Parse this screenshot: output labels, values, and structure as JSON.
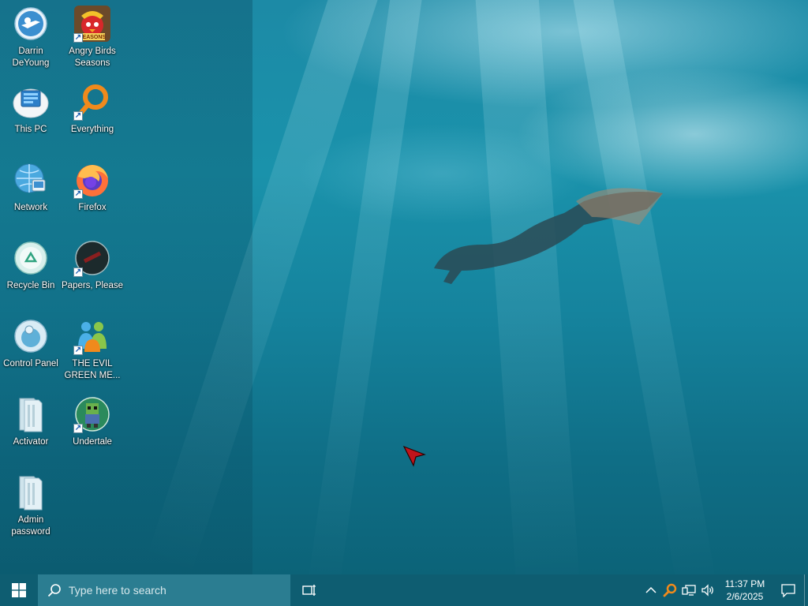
{
  "desktop": {
    "icons": [
      {
        "id": "darrin",
        "label": "Darrin DeYoung",
        "icon": "user-folder-icon",
        "shortcut": false
      },
      {
        "id": "angrybirds",
        "label": "Angry Birds Seasons",
        "icon": "angry-birds-icon",
        "shortcut": true,
        "badge_text": "SEASONS"
      },
      {
        "id": "thispc",
        "label": "This PC",
        "icon": "computer-icon",
        "shortcut": false
      },
      {
        "id": "everything",
        "label": "Everything",
        "icon": "magnifier-icon",
        "shortcut": true
      },
      {
        "id": "network",
        "label": "Network",
        "icon": "network-globe-icon",
        "shortcut": false
      },
      {
        "id": "firefox",
        "label": "Firefox",
        "icon": "firefox-icon",
        "shortcut": true
      },
      {
        "id": "recycle",
        "label": "Recycle Bin",
        "icon": "recycle-bin-icon",
        "shortcut": false
      },
      {
        "id": "papers",
        "label": "Papers, Please",
        "icon": "papers-please-icon",
        "shortcut": true
      },
      {
        "id": "control",
        "label": "Control Panel",
        "icon": "control-panel-icon",
        "shortcut": false
      },
      {
        "id": "evilgreen",
        "label": "THE EVIL GREEN ME...",
        "icon": "messenger-people-icon",
        "shortcut": true
      },
      {
        "id": "activator",
        "label": "Activator",
        "icon": "folder-icon",
        "shortcut": false
      },
      {
        "id": "undertale",
        "label": "Undertale",
        "icon": "undertale-icon",
        "shortcut": true
      },
      {
        "id": "adminpw",
        "label": "Admin password",
        "icon": "folder-icon",
        "shortcut": false
      }
    ]
  },
  "taskbar": {
    "start_icon": "windows-logo-icon",
    "search_placeholder": "Type here to search",
    "taskview_icon": "task-view-icon",
    "tray": {
      "chevron_icon": "chevron-up-icon",
      "app_icon": "everything-tray-icon",
      "network_icon": "network-icon",
      "volume_icon": "volume-icon"
    },
    "clock": {
      "time": "11:37 PM",
      "date": "2/6/2025"
    },
    "notification_icon": "action-center-icon"
  },
  "colors": {
    "taskbar": "#0e5d71",
    "search_box": "#2b7d91",
    "wallpaper_deep": "#0f6e86",
    "wallpaper_light": "#1a92ab"
  }
}
